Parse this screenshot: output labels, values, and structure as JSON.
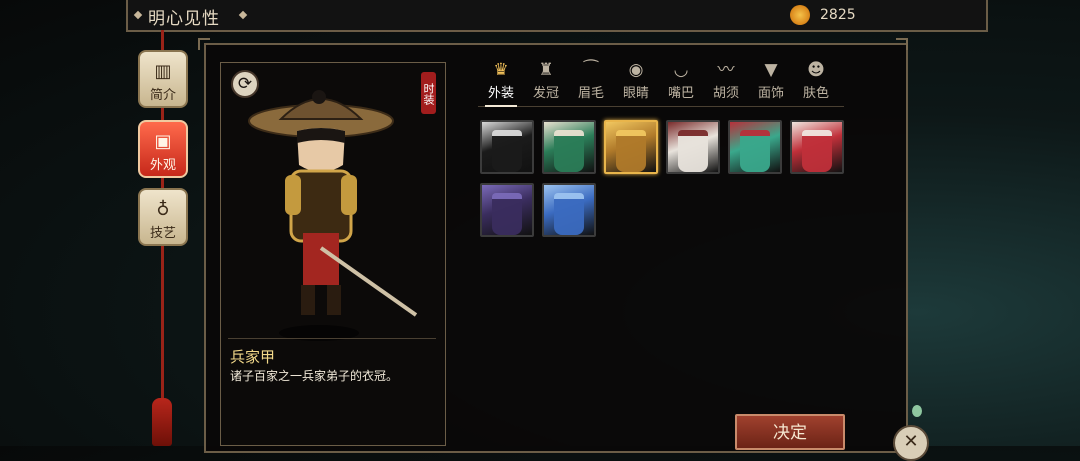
{
  "header": {
    "title": "明心见性",
    "currency_icon": "currency-coin-icon",
    "currency_value": "2825"
  },
  "side_nav": [
    {
      "label": "简介",
      "icon": "book-icon",
      "active": false
    },
    {
      "label": "外观",
      "icon": "portrait-icon",
      "active": true
    },
    {
      "label": "技艺",
      "icon": "lute-icon",
      "active": false
    }
  ],
  "preview": {
    "tag": "时装",
    "item_name": "兵家甲",
    "item_desc": "诸子百家之一兵家弟子的衣冠。"
  },
  "tabs": [
    {
      "label": "外装",
      "icon": "outfit-icon",
      "active": true
    },
    {
      "label": "发冠",
      "icon": "hair-crown-icon",
      "active": false
    },
    {
      "label": "眉毛",
      "icon": "eyebrow-icon",
      "active": false
    },
    {
      "label": "眼睛",
      "icon": "eye-icon",
      "active": false
    },
    {
      "label": "嘴巴",
      "icon": "mouth-icon",
      "active": false
    },
    {
      "label": "胡须",
      "icon": "mustache-icon",
      "active": false
    },
    {
      "label": "面饰",
      "icon": "mask-icon",
      "active": false
    },
    {
      "label": "肤色",
      "icon": "face-icon",
      "active": false
    }
  ],
  "outfits": [
    {
      "color": "#1b1b1b",
      "accent": "#d9d9d9"
    },
    {
      "color": "#2b7d58",
      "accent": "#e8e1d0"
    },
    {
      "color": "#b07a2a",
      "accent": "#f1c760",
      "selected": true
    },
    {
      "color": "#e8e3dc",
      "accent": "#7a2b2b"
    },
    {
      "color": "#3aa88c",
      "accent": "#b7303a"
    },
    {
      "color": "#c0303a",
      "accent": "#f0e6df"
    },
    {
      "color": "#3a2d5e",
      "accent": "#7a6ab8"
    },
    {
      "color": "#3b6bc0",
      "accent": "#9cc3f0"
    }
  ],
  "confirm_label": "决定"
}
